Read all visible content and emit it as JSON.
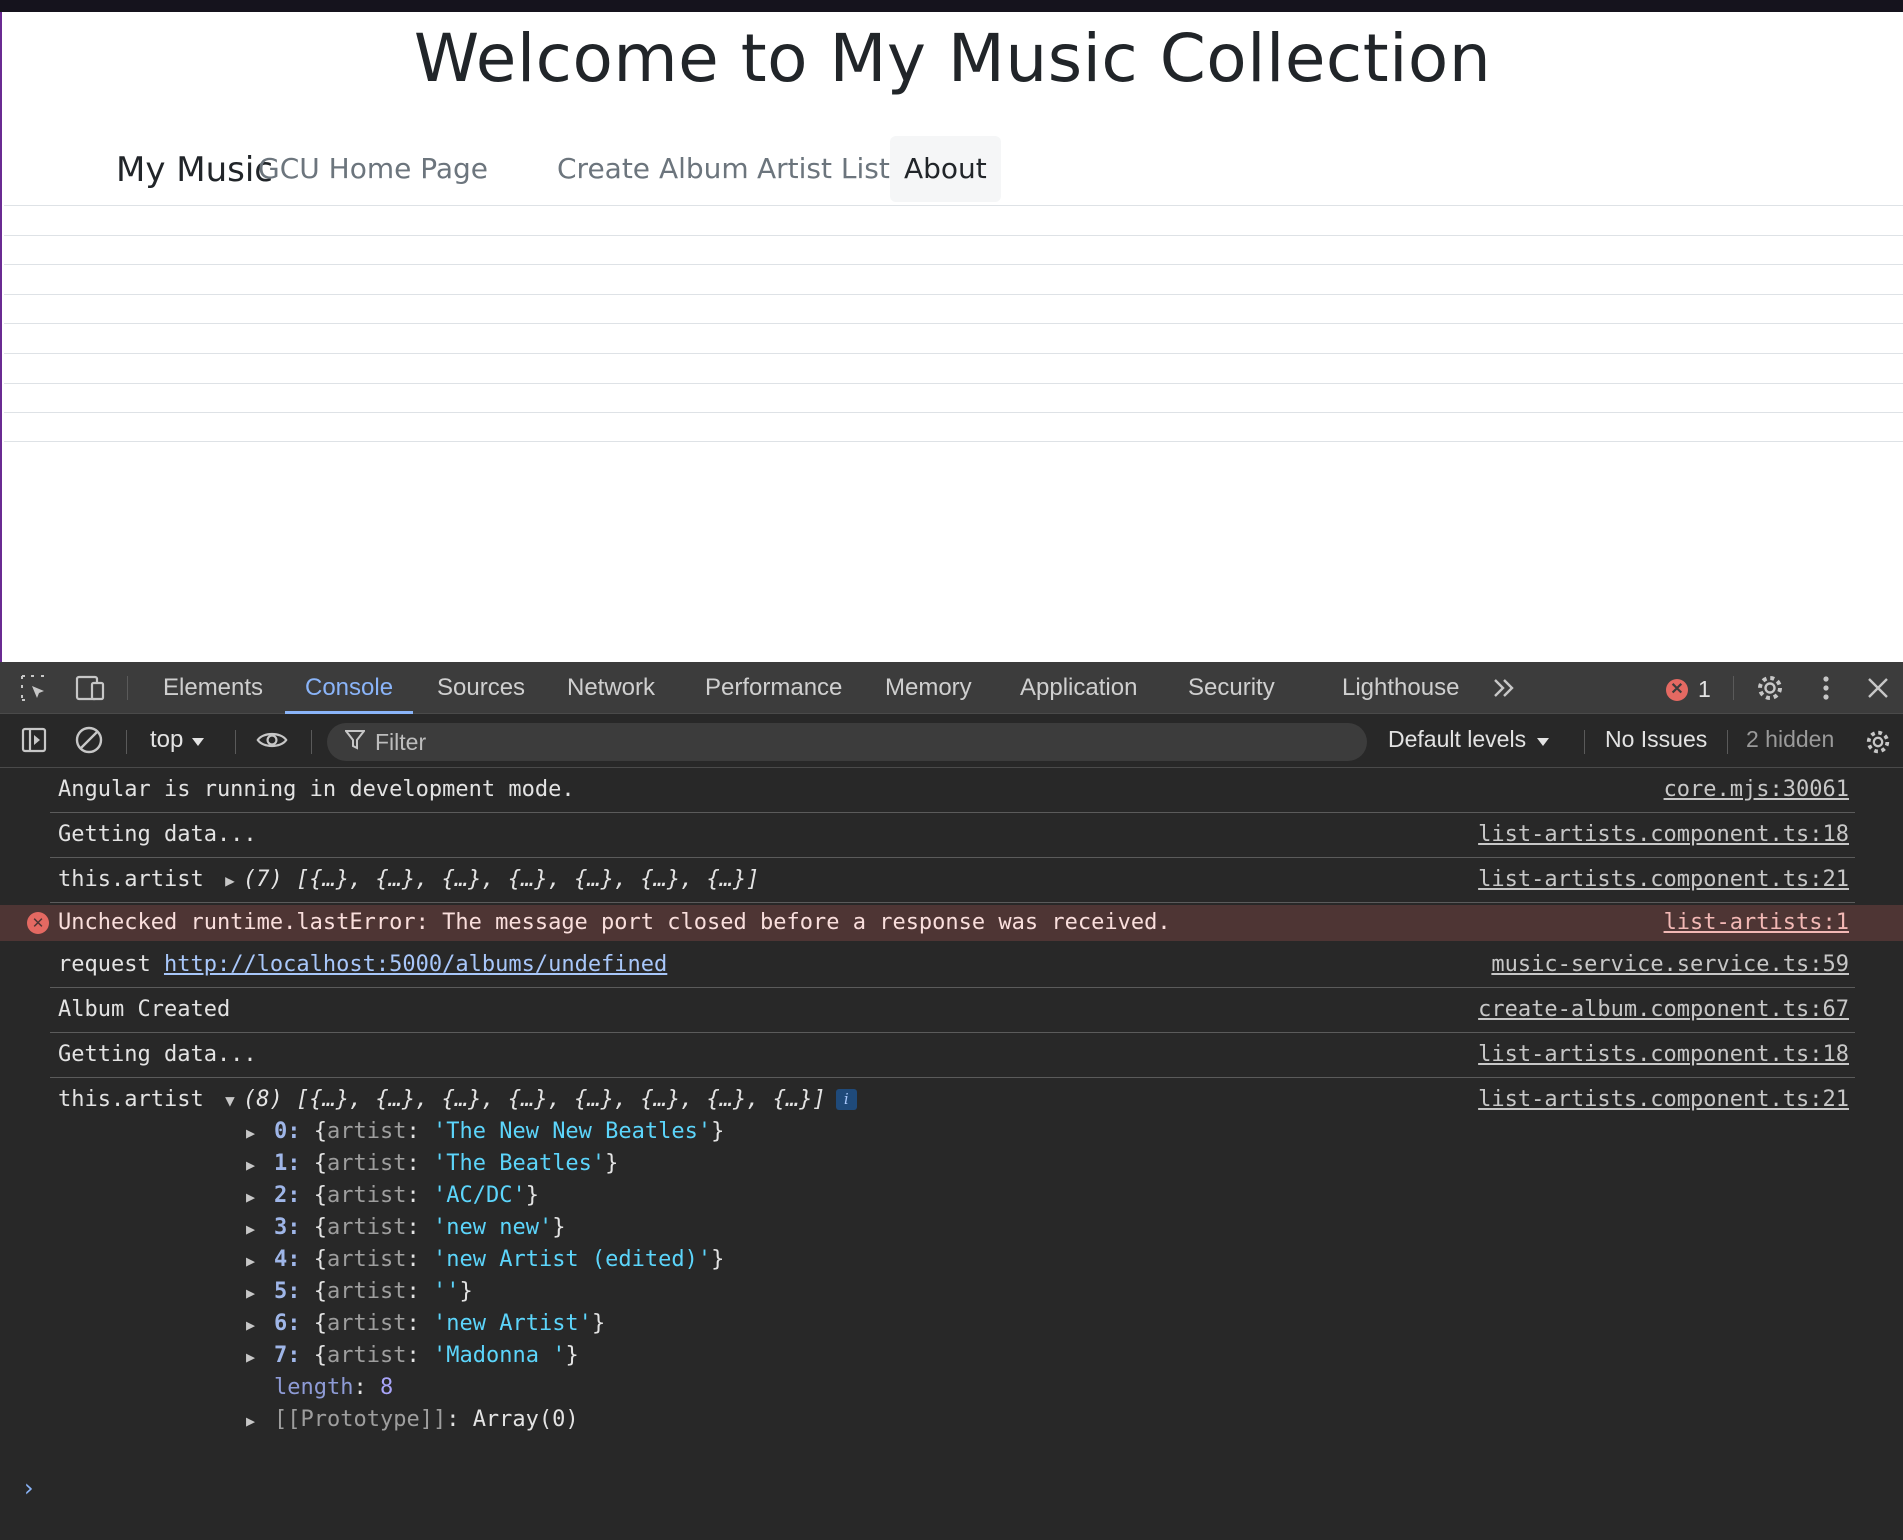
{
  "page": {
    "title": "Welcome to My Music Collection",
    "brand": "My Music",
    "nav": [
      {
        "label": "GCU Home Page"
      },
      {
        "label": "Create Album"
      },
      {
        "label": "Artist List"
      },
      {
        "label": "About"
      }
    ]
  },
  "devtools": {
    "tabs": [
      "Elements",
      "Console",
      "Sources",
      "Network",
      "Performance",
      "Memory",
      "Application",
      "Security",
      "Lighthouse"
    ],
    "active_tab": "Console",
    "error_count": "1",
    "toolbar": {
      "context": "top",
      "filter_placeholder": "Filter",
      "levels": "Default levels",
      "issues": "No Issues",
      "hidden": "2 hidden"
    },
    "logs": [
      {
        "text": "Angular is running in development mode.",
        "source": "core.mjs:30061"
      },
      {
        "text": "Getting data...",
        "source": "list-artists.component.ts:18"
      },
      {
        "label": "this.artist",
        "count": "(7)",
        "preview": "[{…}, {…}, {…}, {…}, {…}, {…}, {…}]",
        "source": "list-artists.component.ts:21"
      },
      {
        "text": "Unchecked runtime.lastError: The message port closed before a response was received.",
        "source": "list-artists:1"
      },
      {
        "text": "request",
        "url": "http://localhost:5000/albums/undefined",
        "source": "music-service.service.ts:59"
      },
      {
        "text": "Album Created",
        "source": "create-album.component.ts:67"
      },
      {
        "text": "Getting data...",
        "source": "list-artists.component.ts:18"
      },
      {
        "label": "this.artist",
        "count": "(8)",
        "preview": "[{…}, {…}, {…}, {…}, {…}, {…}, {…}, {…}]",
        "source": "list-artists.component.ts:21",
        "info": "i"
      }
    ],
    "array_items": [
      {
        "index": "0",
        "key": "artist",
        "value": "'The New New Beatles'"
      },
      {
        "index": "1",
        "key": "artist",
        "value": "'The Beatles'"
      },
      {
        "index": "2",
        "key": "artist",
        "value": "'AC/DC'"
      },
      {
        "index": "3",
        "key": "artist",
        "value": "'new new'"
      },
      {
        "index": "4",
        "key": "artist",
        "value": "'new Artist (edited)'"
      },
      {
        "index": "5",
        "key": "artist",
        "value": "''"
      },
      {
        "index": "6",
        "key": "artist",
        "value": "'new Artist'"
      },
      {
        "index": "7",
        "key": "artist",
        "value": "'Madonna '"
      }
    ],
    "length_label": "length",
    "length_value": "8",
    "prototype_label": "[[Prototype]]",
    "prototype_value": "Array(0)",
    "prompt": "›"
  }
}
